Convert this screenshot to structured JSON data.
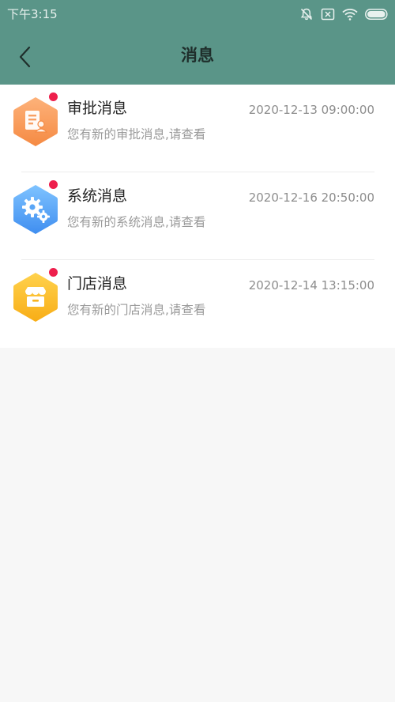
{
  "status_bar": {
    "time": "下午3:15",
    "icons": [
      "notifications-off-icon",
      "no-sim-icon",
      "wifi-icon",
      "battery-icon"
    ]
  },
  "header": {
    "title": "消息",
    "back_icon": "back-arrow-icon"
  },
  "messages": [
    {
      "title": "审批消息",
      "time": "2020-12-13 09:00:00",
      "preview": "您有新的审批消息,请查看",
      "icon": "approval-document-icon",
      "unread": true,
      "color_top": "#fdb27a",
      "color_bottom": "#f58a43"
    },
    {
      "title": "系统消息",
      "time": "2020-12-16 20:50:00",
      "preview": "您有新的系统消息,请查看",
      "icon": "gears-icon",
      "unread": true,
      "color_top": "#7fc3ff",
      "color_bottom": "#3f8ef0"
    },
    {
      "title": "门店消息",
      "time": "2020-12-14 13:15:00",
      "preview": "您有新的门店消息,请查看",
      "icon": "store-icon",
      "unread": true,
      "color_top": "#ffd24d",
      "color_bottom": "#f8ad16"
    }
  ],
  "colors": {
    "header_bg": "#5a9588",
    "page_bg": "#f7f7f7",
    "unread_dot": "#ee1f4c"
  }
}
